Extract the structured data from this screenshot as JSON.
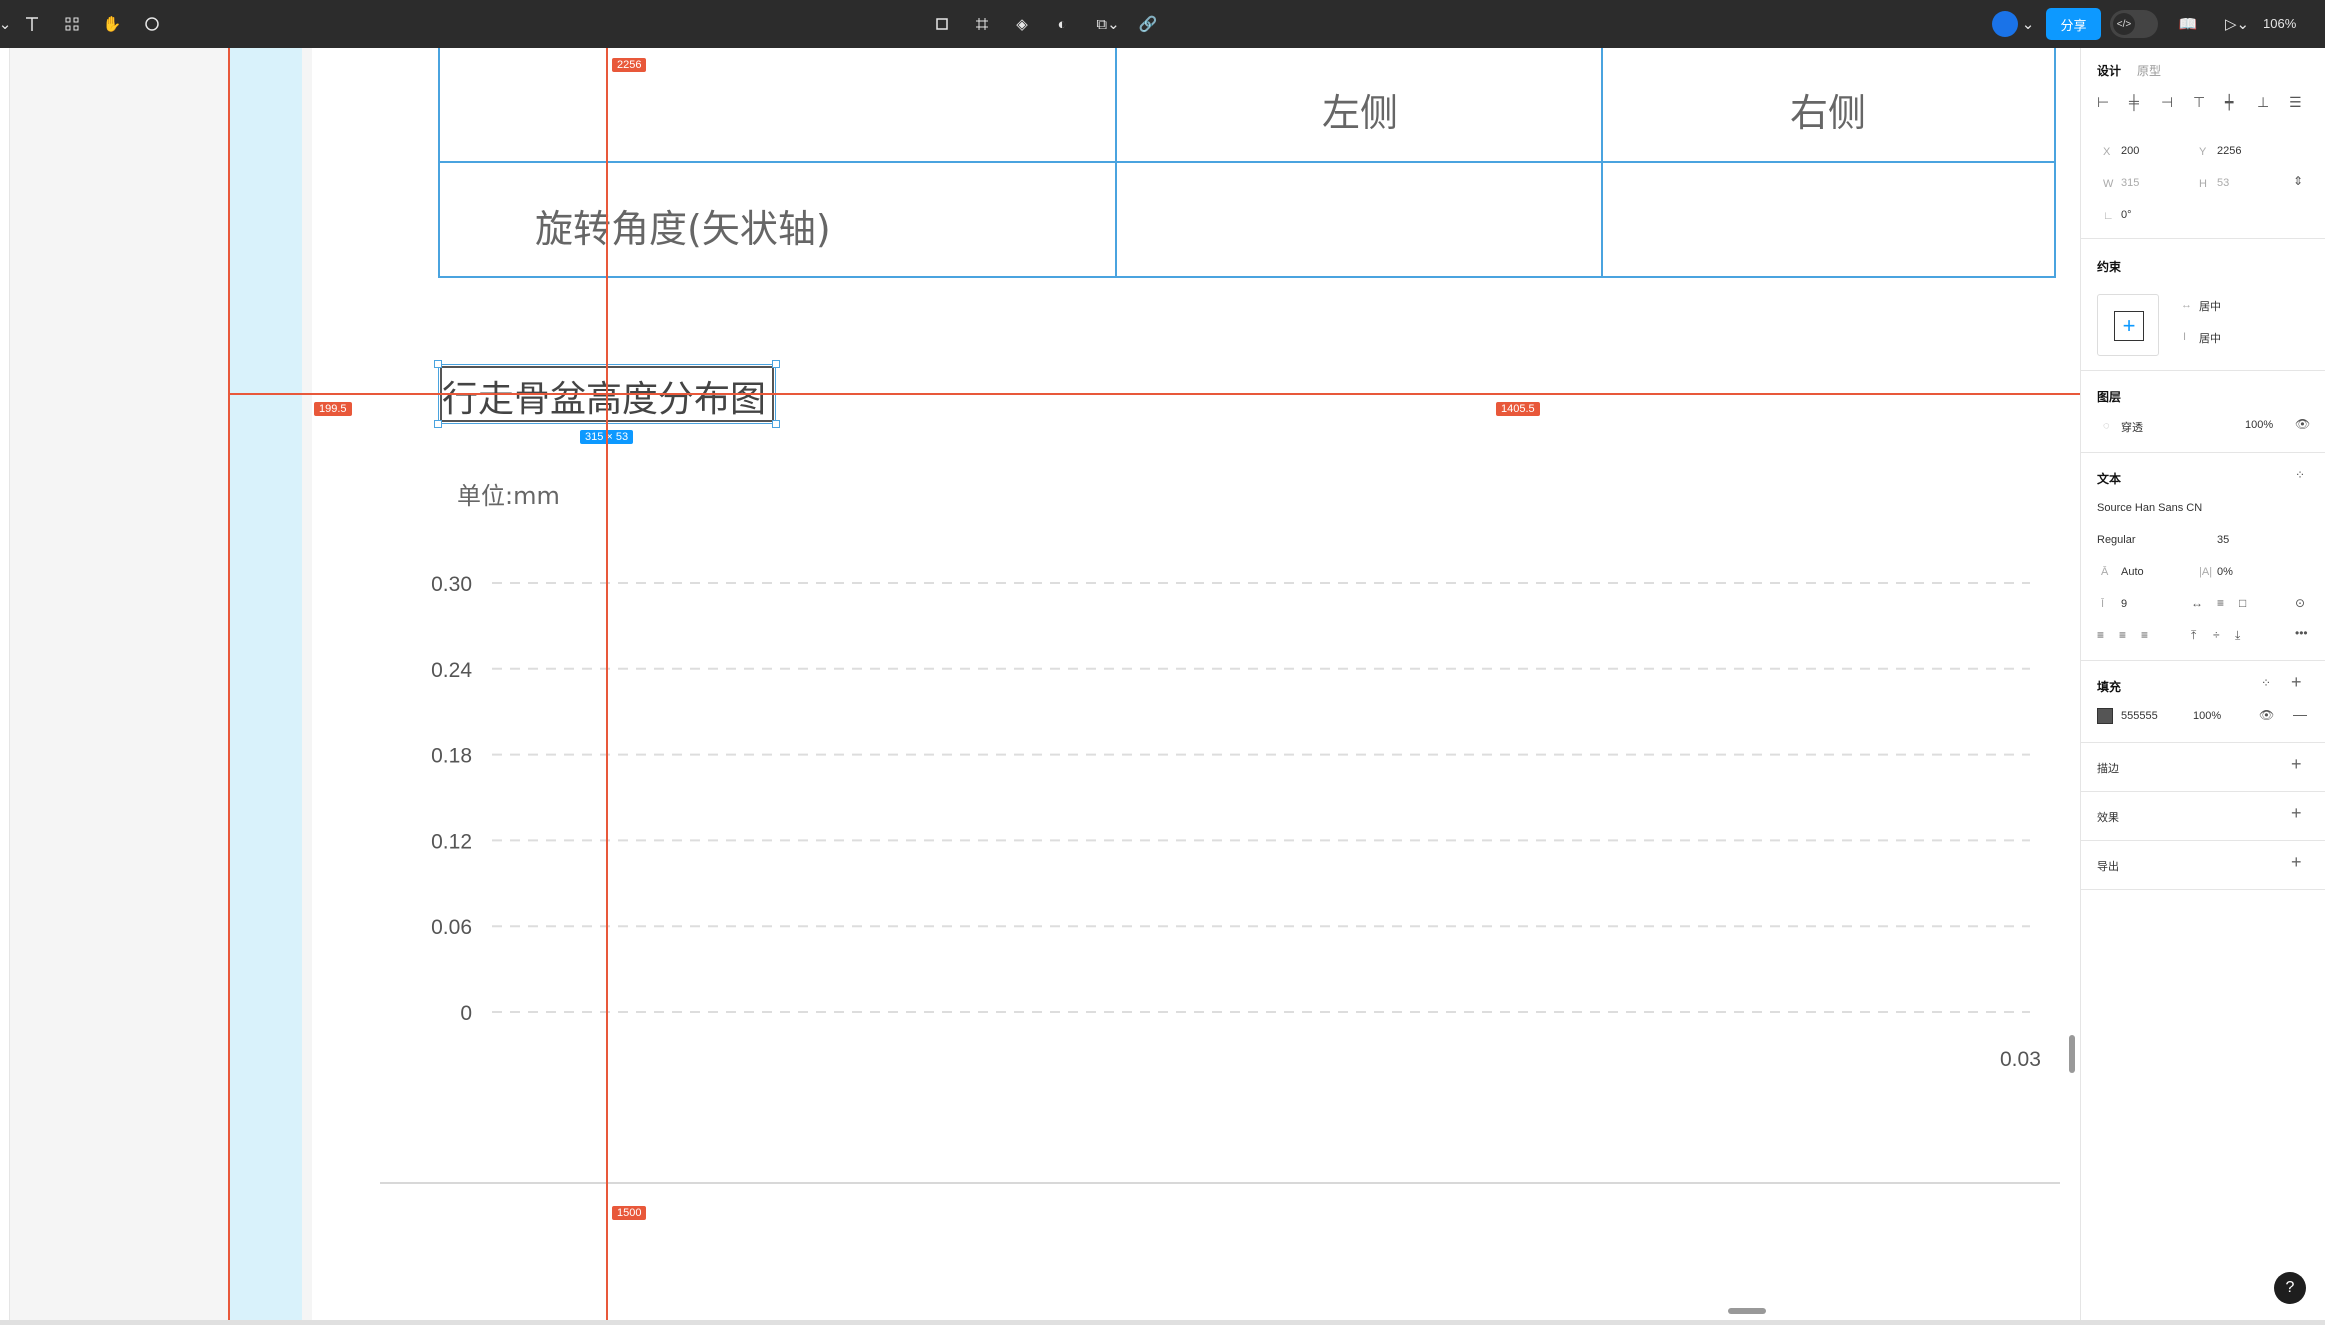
{
  "toolbar": {
    "share_label": "分享",
    "zoom": "106%"
  },
  "canvas": {
    "table": {
      "header_left": "左侧",
      "header_right": "右侧",
      "row1_label": "旋转角度(矢状轴)"
    },
    "selected_title": "行走骨盆高度分布图",
    "size_badge": "315 × 53",
    "unit": "单位:mm",
    "corner_value": "0.03",
    "guides": {
      "top": "2256",
      "left": "199.5",
      "right": "1405.5",
      "bottom": "1500"
    }
  },
  "chart_data": {
    "type": "bar",
    "ylim": [
      0,
      0.3
    ],
    "yticks": [
      "0.30",
      "0.24",
      "0.18",
      "0.12",
      "0.06",
      "0"
    ],
    "categories": [],
    "series": [],
    "grid": true
  },
  "design_panel": {
    "tab_design": "设计",
    "tab_prototype": "原型",
    "x_label": "X",
    "x_value": "200",
    "y_label": "Y",
    "y_value": "2256",
    "w_label": "W",
    "w_value": "315",
    "h_label": "H",
    "h_value": "53",
    "rotation": "0°",
    "constraints_title": "约束",
    "constraint_h": "居中",
    "constraint_v": "居中",
    "layer_title": "图层",
    "blend_mode": "穿透",
    "layer_opacity": "100%",
    "text_title": "文本",
    "font_family": "Source Han Sans CN",
    "font_weight": "Regular",
    "font_size": "35",
    "line_height": "Auto",
    "letter_spacing": "0%",
    "paragraph_spacing": "9",
    "fill_title": "填充",
    "fill_hex": "555555",
    "fill_opacity": "100%",
    "fill_color": "#555555",
    "stroke_title": "描边",
    "effects_title": "效果",
    "export_title": "导出"
  }
}
